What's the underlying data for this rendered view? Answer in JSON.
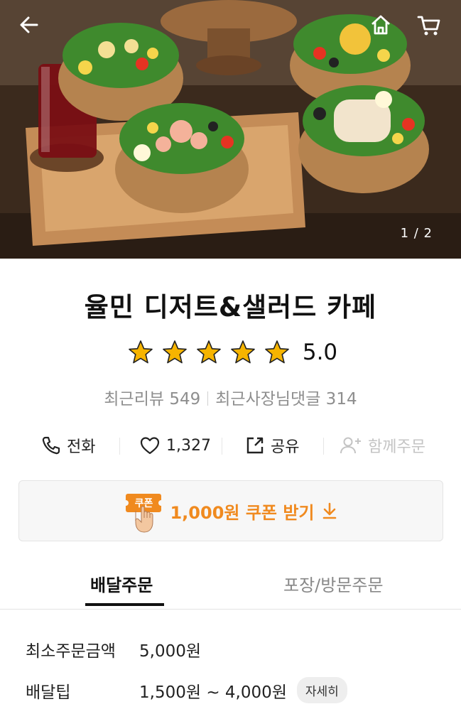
{
  "hero": {
    "image_counter": "1 / 2"
  },
  "store": {
    "name": "율민 디저트&샐러드 카페",
    "rating_stars": 5,
    "rating_value": "5.0",
    "recent_reviews": "최근리뷰 549",
    "owner_replies": "최근사장님댓글 314"
  },
  "actions": {
    "call_label": "전화",
    "like_count": "1,327",
    "share_label": "공유",
    "group_order_label": "함께주문"
  },
  "coupon": {
    "tag_text": "쿠폰",
    "label": "1,000원 쿠폰 받기"
  },
  "tabs": [
    {
      "label": "배달주문",
      "active": true
    },
    {
      "label": "포장/방문주문",
      "active": false
    }
  ],
  "info": {
    "min_order_key": "최소주문금액",
    "min_order_value": "5,000원",
    "delivery_tip_key": "배달팁",
    "delivery_tip_value": "1,500원 ~ 4,000원",
    "detail_button": "자세히"
  },
  "colors": {
    "accent": "#f08a1f",
    "star": "#f6b400",
    "muted": "#8e8e8e"
  },
  "icons": [
    "back-arrow-icon",
    "home-icon",
    "cart-icon",
    "star-icon",
    "phone-icon",
    "heart-icon",
    "share-icon",
    "add-person-icon",
    "download-arrow-icon",
    "coupon-hand-icon"
  ]
}
